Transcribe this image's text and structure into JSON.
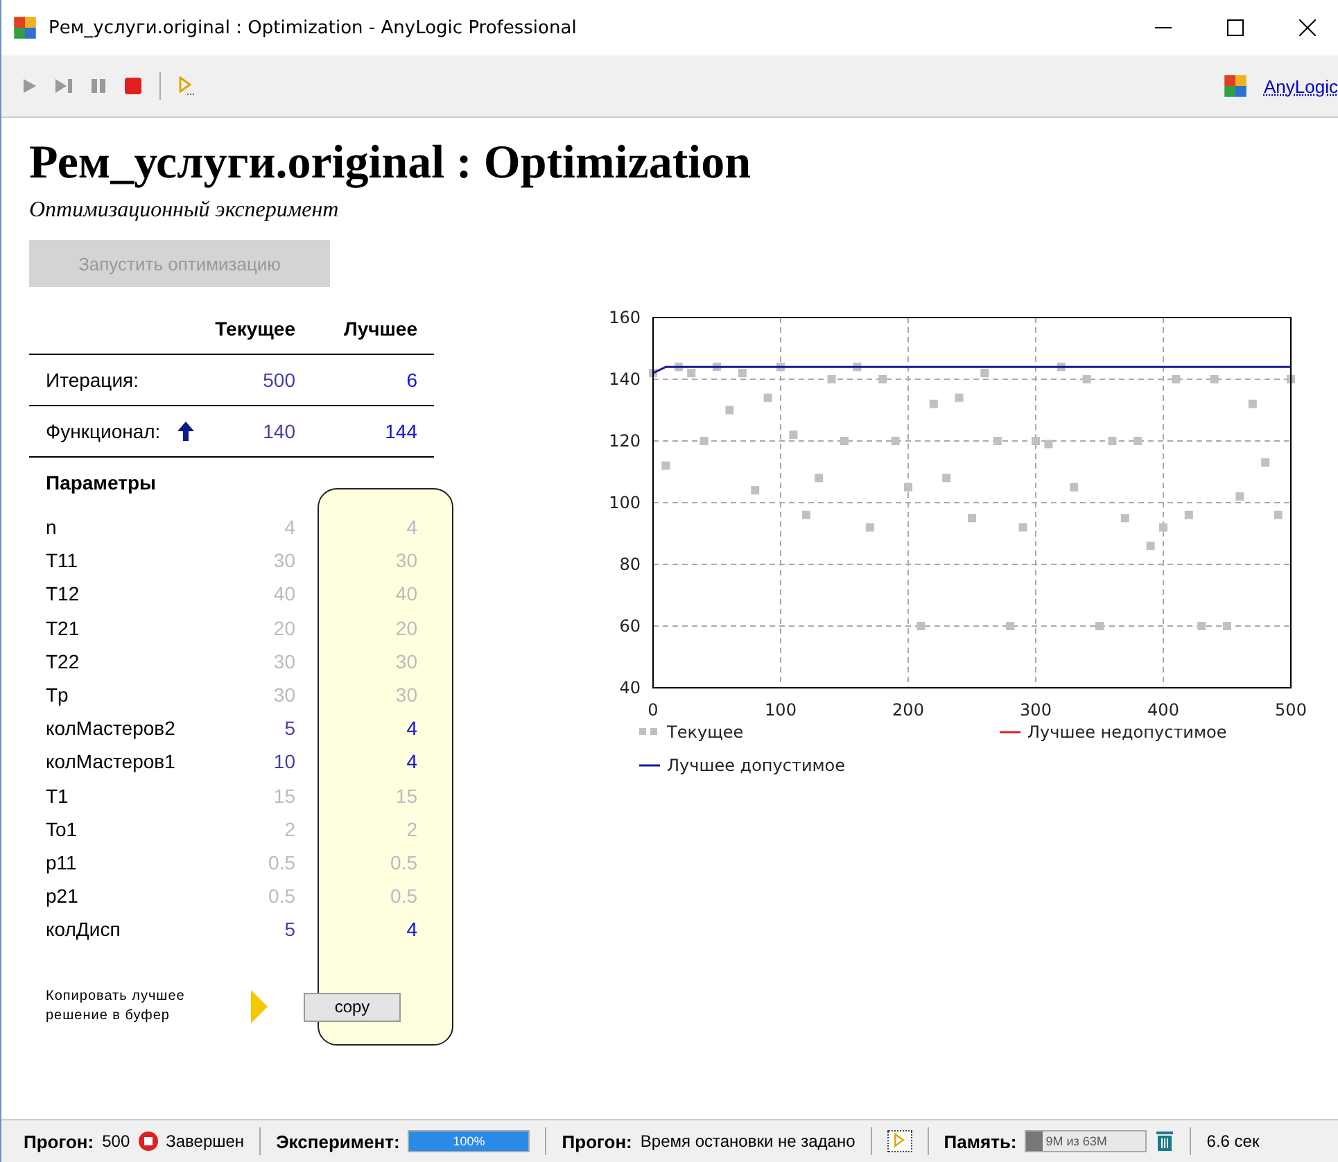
{
  "window": {
    "title": "Рем_услуги.original : Optimization - AnyLogic Professional"
  },
  "toolbar": {
    "link": "AnyLogic"
  },
  "heading": "Рем_услуги.original : Optimization",
  "subtitle": "Оптимизационный эксперимент",
  "run_button": {
    "label": "Запустить оптимизацию",
    "disabled": true
  },
  "results": {
    "columns": [
      "Текущее",
      "Лучшее"
    ],
    "rows": [
      {
        "label": "Итерация:",
        "current": "500",
        "best": "6",
        "maximize": false
      },
      {
        "label": "Функционал:",
        "current": "140",
        "best": "144",
        "maximize": true
      }
    ]
  },
  "parameters": {
    "title": "Параметры",
    "items": [
      {
        "name": "n",
        "current": "4",
        "best": "4",
        "optimized": false
      },
      {
        "name": "T11",
        "current": "30",
        "best": "30",
        "optimized": false
      },
      {
        "name": "T12",
        "current": "40",
        "best": "40",
        "optimized": false
      },
      {
        "name": "T21",
        "current": "20",
        "best": "20",
        "optimized": false
      },
      {
        "name": "T22",
        "current": "30",
        "best": "30",
        "optimized": false
      },
      {
        "name": "Tp",
        "current": "30",
        "best": "30",
        "optimized": false
      },
      {
        "name": "колМастеров2",
        "current": "5",
        "best": "4",
        "optimized": true
      },
      {
        "name": "колМастеров1",
        "current": "10",
        "best": "4",
        "optimized": true
      },
      {
        "name": "T1",
        "current": "15",
        "best": "15",
        "optimized": false
      },
      {
        "name": "To1",
        "current": "2",
        "best": "2",
        "optimized": false
      },
      {
        "name": "p11",
        "current": "0.5",
        "best": "0.5",
        "optimized": false
      },
      {
        "name": "p21",
        "current": "0.5",
        "best": "0.5",
        "optimized": false
      },
      {
        "name": "колДисп",
        "current": "5",
        "best": "4",
        "optimized": true
      }
    ],
    "copy_label": "Копировать лучшее решение в буфер",
    "copy_button": "copy"
  },
  "chart_data": {
    "type": "scatter",
    "grid": true,
    "legend": true,
    "xlim": [
      0,
      500
    ],
    "ylim": [
      40,
      160
    ],
    "xticks": [
      0,
      100,
      200,
      300,
      400,
      500
    ],
    "yticks": [
      40,
      60,
      80,
      100,
      120,
      140,
      160
    ],
    "x": [
      0,
      10,
      20,
      30,
      40,
      50,
      60,
      70,
      80,
      90,
      100,
      110,
      120,
      130,
      140,
      150,
      160,
      170,
      180,
      190,
      200,
      210,
      220,
      230,
      240,
      250,
      260,
      270,
      280,
      290,
      300,
      310,
      320,
      330,
      340,
      350,
      360,
      370,
      380,
      390,
      400,
      410,
      420,
      430,
      440,
      450,
      460,
      470,
      480,
      490,
      500
    ],
    "series": [
      {
        "name": "Текущее",
        "color": "#c0c0c0",
        "values": [
          142,
          112,
          144,
          142,
          120,
          144,
          130,
          142,
          104,
          134,
          144,
          122,
          96,
          108,
          140,
          120,
          144,
          92,
          140,
          120,
          105,
          60,
          132,
          108,
          134,
          95,
          142,
          120,
          60,
          92,
          120,
          119,
          144,
          105,
          140,
          60,
          120,
          95,
          120,
          86,
          92,
          140,
          96,
          60,
          140,
          60,
          102,
          132,
          113,
          96,
          140
        ]
      },
      {
        "name": "Лучшее недопустимое",
        "type": "line",
        "color": "#e02020",
        "values": [
          null,
          null,
          null,
          null,
          null,
          null,
          null,
          null,
          null,
          null,
          null,
          null,
          null,
          null,
          null,
          null,
          null,
          null,
          null,
          null,
          null,
          null,
          null,
          null,
          null,
          null,
          null,
          null,
          null,
          null,
          null,
          null,
          null,
          null,
          null,
          null,
          null,
          null,
          null,
          null,
          null,
          null,
          null,
          null,
          null,
          null,
          null,
          null,
          null,
          null,
          null
        ]
      },
      {
        "name": "Лучшее допустимое",
        "type": "line",
        "color": "#1a1a9a",
        "values": [
          142,
          144,
          144,
          144,
          144,
          144,
          144,
          144,
          144,
          144,
          144,
          144,
          144,
          144,
          144,
          144,
          144,
          144,
          144,
          144,
          144,
          144,
          144,
          144,
          144,
          144,
          144,
          144,
          144,
          144,
          144,
          144,
          144,
          144,
          144,
          144,
          144,
          144,
          144,
          144,
          144,
          144,
          144,
          144,
          144,
          144,
          144,
          144,
          144,
          144,
          144
        ]
      }
    ]
  },
  "status_bar": {
    "run_label": "Прогон:",
    "run_count": "500",
    "run_state": "Завершен",
    "experiment_label": "Эксперимент:",
    "progress_text": "100%",
    "progress": {
      "level": 1
    },
    "stop_label": "Прогон:",
    "stop_text": "Время остановки не задано",
    "memory_label": "Память:",
    "memory_text": "9M из 63M",
    "memory": {
      "level": 0.14
    },
    "time": "6.6 сек"
  }
}
